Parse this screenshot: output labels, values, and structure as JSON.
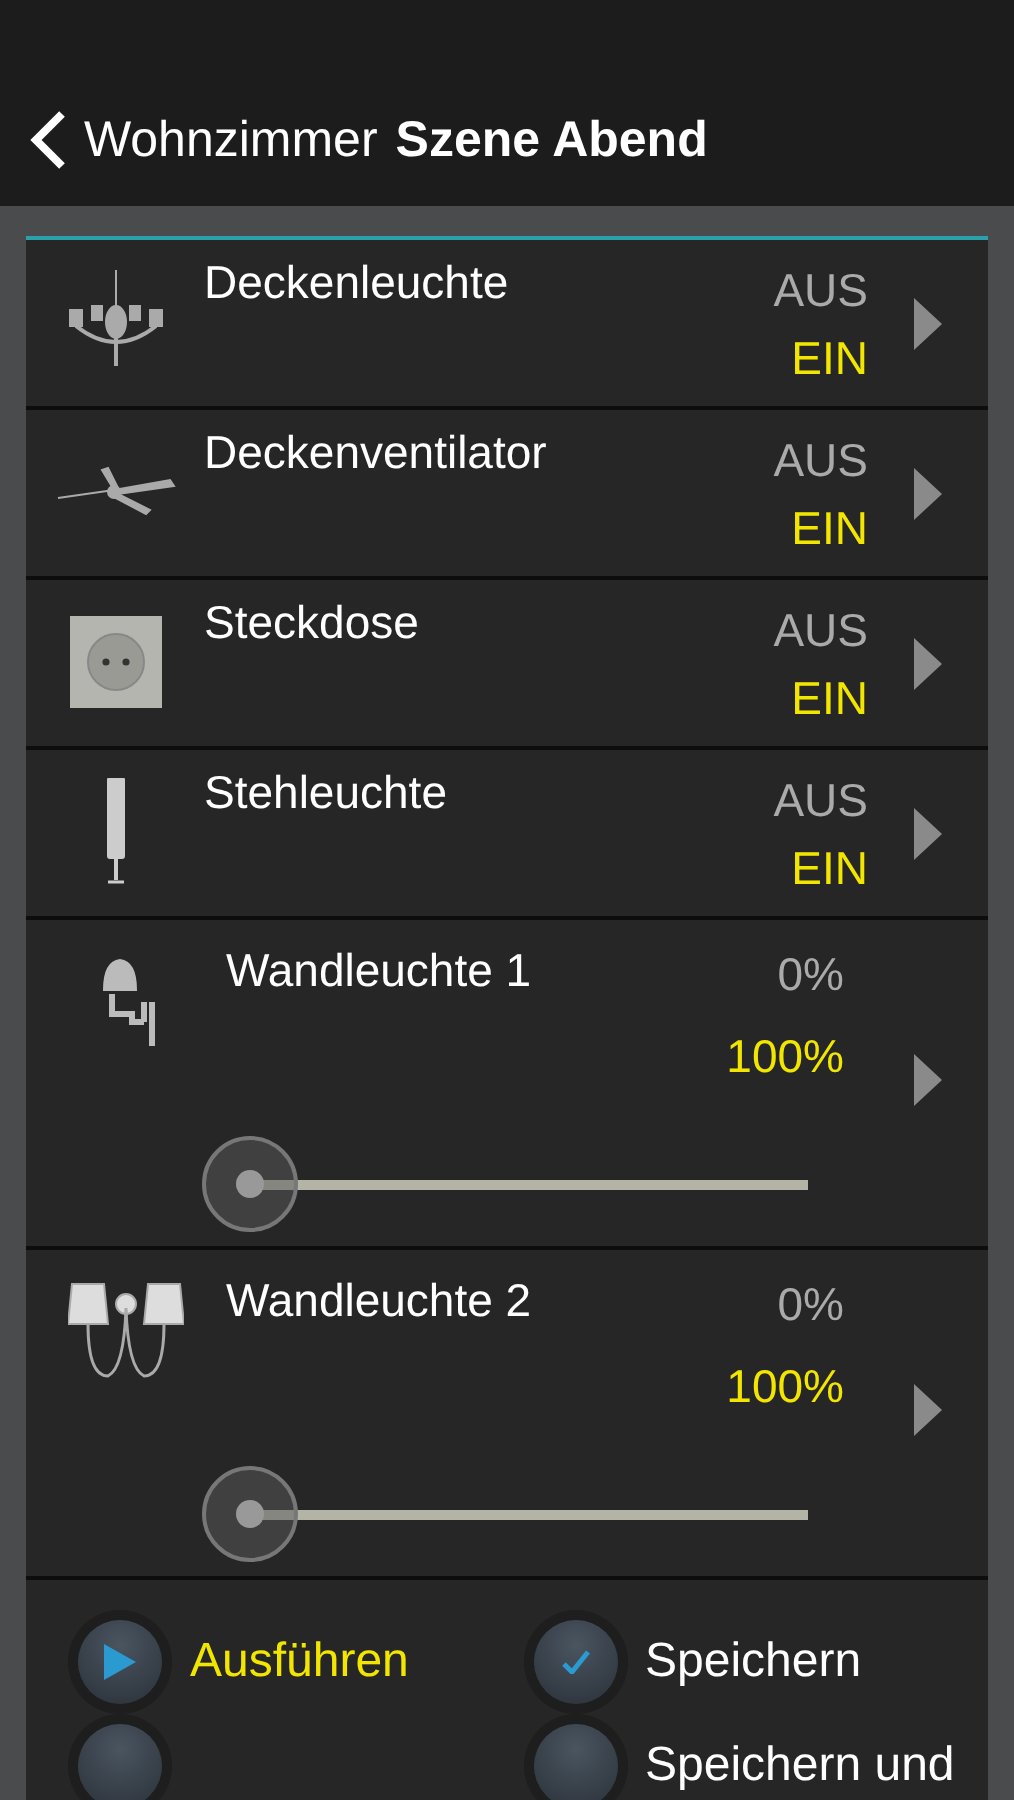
{
  "header": {
    "back": "Wohnzimmer",
    "title": "Szene Abend"
  },
  "devices": [
    {
      "kind": "switch",
      "name": "Deckenleuchte",
      "options": [
        {
          "label": "AUS",
          "selected": false
        },
        {
          "label": "EIN",
          "selected": true
        }
      ]
    },
    {
      "kind": "switch",
      "name": "Deckenventilator",
      "options": [
        {
          "label": "AUS",
          "selected": false
        },
        {
          "label": "EIN",
          "selected": true
        }
      ]
    },
    {
      "kind": "switch",
      "name": "Steckdose",
      "options": [
        {
          "label": "AUS",
          "selected": false
        },
        {
          "label": "EIN",
          "selected": true
        }
      ]
    },
    {
      "kind": "switch",
      "name": "Stehleuchte",
      "options": [
        {
          "label": "AUS",
          "selected": false
        },
        {
          "label": "EIN",
          "selected": true
        }
      ]
    },
    {
      "kind": "dimmer",
      "name": "Wandleuchte 1",
      "options": [
        {
          "label": "0%",
          "selected": false
        },
        {
          "label": "100%",
          "selected": true
        }
      ],
      "level": 0
    },
    {
      "kind": "dimmer",
      "name": "Wandleuchte 2",
      "options": [
        {
          "label": "0%",
          "selected": false
        },
        {
          "label": "100%",
          "selected": true
        }
      ],
      "level": 0
    }
  ],
  "actions": [
    {
      "kind": "play",
      "label": "Ausführen",
      "selected": true
    },
    {
      "kind": "check",
      "label": "Speichern",
      "selected": false
    },
    {
      "kind": "plain",
      "selected": false
    },
    {
      "kind": "plain",
      "label": "Speichern und",
      "selected": false
    }
  ]
}
